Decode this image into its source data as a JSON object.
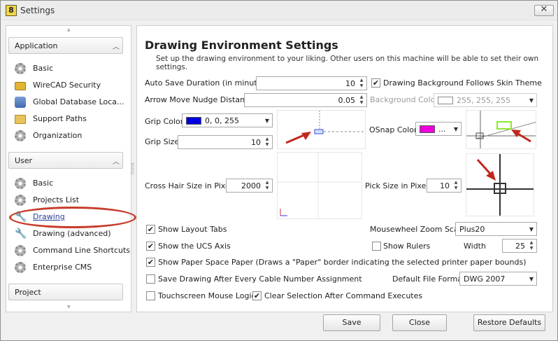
{
  "window": {
    "title": "Settings",
    "app_icon_glyph": "8",
    "close_glyph": "✕"
  },
  "sidebar": {
    "groups": [
      {
        "label": "Application",
        "items": [
          {
            "label": "Basic",
            "icon": "gear-icon"
          },
          {
            "label": "WireCAD Security",
            "icon": "lock-icon"
          },
          {
            "label": "Global Database Loca...",
            "icon": "database-icon"
          },
          {
            "label": "Support Paths",
            "icon": "folder-icon"
          },
          {
            "label": "Organization",
            "icon": "gear-icon"
          }
        ]
      },
      {
        "label": "User",
        "items": [
          {
            "label": "Basic",
            "icon": "gear-icon"
          },
          {
            "label": "Projects List",
            "icon": "gear-icon"
          },
          {
            "label": "Drawing",
            "icon": "wrench-icon",
            "selected": true
          },
          {
            "label": "Drawing (advanced)",
            "icon": "wrench-icon"
          },
          {
            "label": "Command Line Shortcuts",
            "icon": "gear-icon"
          },
          {
            "label": "Enterprise CMS",
            "icon": "gear-icon"
          }
        ]
      },
      {
        "label": "Project",
        "items": []
      }
    ]
  },
  "main": {
    "heading": "Drawing Environment Settings",
    "subtitle": "Set up the drawing environment to your liking. Other users on this machine will be able to set their own settings.",
    "auto_save": {
      "label": "Auto Save Duration (in minutes)",
      "value": "10"
    },
    "follow_skin": {
      "label": "Drawing Background Follows Skin Theme",
      "checked": true
    },
    "nudge": {
      "label": "Arrow Move Nudge Distance",
      "value": "0.05"
    },
    "background_color": {
      "label": "Background Color",
      "value": "255, 255, 255",
      "swatch": "#ffffff"
    },
    "grip_color": {
      "label": "Grip Color",
      "value": "0, 0, 255",
      "swatch": "#0000e0"
    },
    "grip_size": {
      "label": "Grip Size",
      "value": "10"
    },
    "osnap_color": {
      "label": "OSnap Color",
      "value": "...",
      "swatch": "#ee00dd"
    },
    "crosshair": {
      "label": "Cross Hair Size in Pixels",
      "value": "2000"
    },
    "pick_size": {
      "label": "Pick Size in Pixels",
      "value": "10"
    },
    "show_layout_tabs": {
      "label": "Show Layout Tabs",
      "checked": true
    },
    "zoom_scale": {
      "label": "Mousewheel Zoom Scale",
      "value": "Plus20"
    },
    "show_ucs": {
      "label": "Show the UCS Axis",
      "checked": true
    },
    "show_rulers": {
      "label": "Show Rulers",
      "checked": false
    },
    "width": {
      "label": "Width",
      "value": "25"
    },
    "paper_space": {
      "label": "Show Paper Space Paper (Draws a \"Paper\" border indicating the selected printer paper bounds)",
      "checked": true
    },
    "save_after_cable": {
      "label": "Save Drawing After Every Cable Number Assignment",
      "checked": false
    },
    "default_format": {
      "label": "Default File Format",
      "value": "DWG 2007"
    },
    "touchscreen": {
      "label": "Touchscreen Mouse Logic",
      "checked": false
    },
    "clear_selection": {
      "label": "Clear Selection After Command Executes",
      "checked": true
    }
  },
  "buttons": {
    "save": "Save",
    "close": "Close",
    "restore": "Restore Defaults"
  },
  "glyphs": {
    "check": "✔",
    "up": "▲",
    "down": "▼",
    "chevron_up": "︿",
    "combo": "▼"
  },
  "colors": {
    "highlight_ring": "#c73d2d",
    "arrow": "#c0281e"
  }
}
